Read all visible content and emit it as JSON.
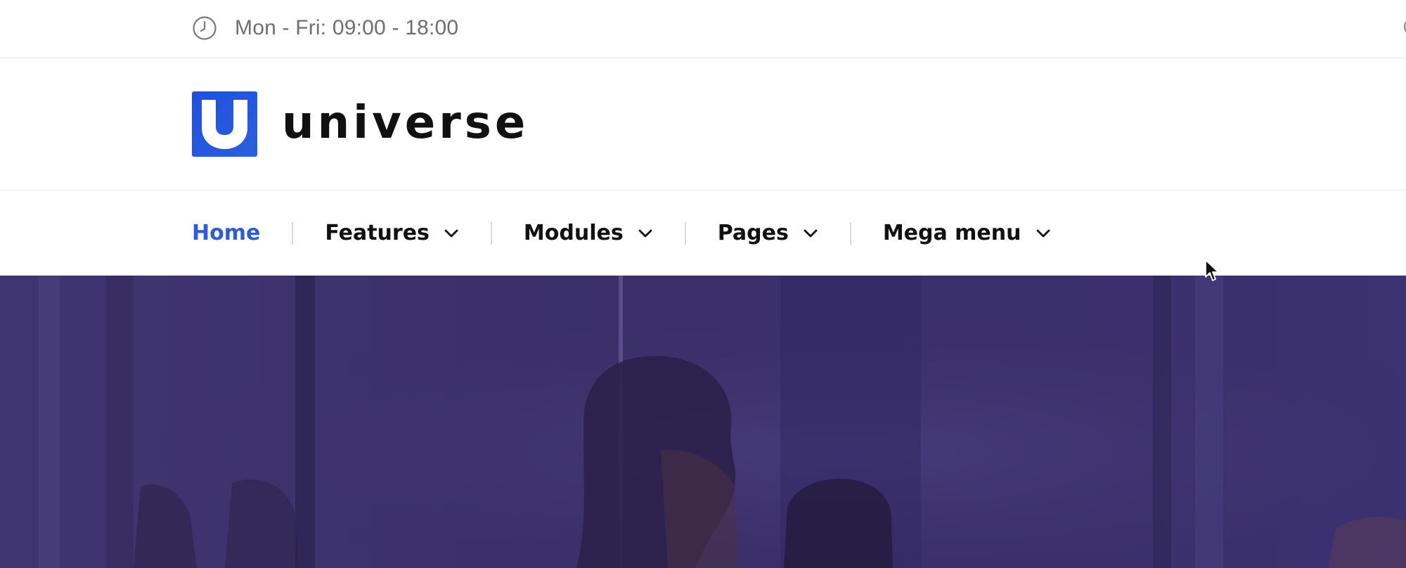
{
  "topbar": {
    "hours_icon": "clock-icon",
    "hours_text": "Mon - Fri: 09:00 - 18:00"
  },
  "brand": {
    "logo_icon": "universe-logo-icon",
    "name": "universe",
    "colors": {
      "logo": "#2e5bd9",
      "text": "#111111"
    }
  },
  "nav": {
    "items": [
      {
        "label": "Home",
        "active": true,
        "has_dropdown": false
      },
      {
        "label": "Features",
        "active": false,
        "has_dropdown": true
      },
      {
        "label": "Modules",
        "active": false,
        "has_dropdown": true
      },
      {
        "label": "Pages",
        "active": false,
        "has_dropdown": true
      },
      {
        "label": "Mega menu",
        "active": false,
        "has_dropdown": true
      }
    ],
    "colors": {
      "active": "#2e5bd9",
      "default": "#111111",
      "separator": "#d9d9d9"
    }
  },
  "hero": {
    "overlay_color": "#3a2f66"
  }
}
